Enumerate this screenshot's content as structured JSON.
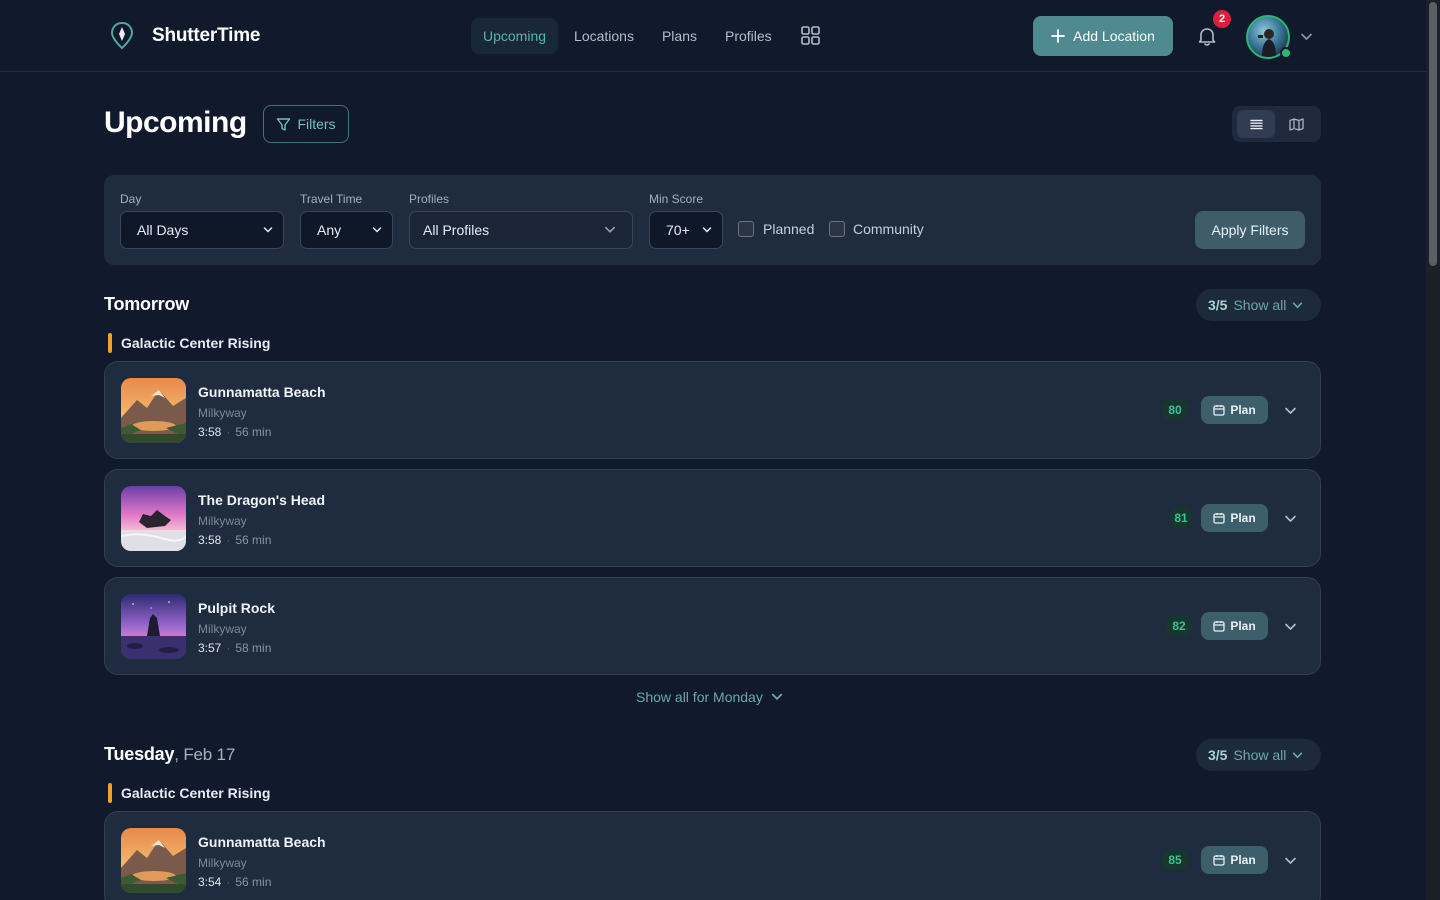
{
  "header": {
    "brand": "ShutterTime",
    "nav": [
      {
        "label": "Upcoming",
        "active": true
      },
      {
        "label": "Locations",
        "active": false
      },
      {
        "label": "Plans",
        "active": false
      },
      {
        "label": "Profiles",
        "active": false
      }
    ],
    "add_location_label": "Add Location",
    "notification_count": "2",
    "icons": [
      "map-pin-logo-icon",
      "grid-icon",
      "plus-icon",
      "bell-icon",
      "chevron-down-icon"
    ]
  },
  "title_row": {
    "title": "Upcoming",
    "filters_label": "Filters",
    "view_modes": [
      "list-icon",
      "map-icon"
    ],
    "active_view": "list"
  },
  "filters": {
    "day": {
      "label": "Day",
      "value": "All Days"
    },
    "travel_time": {
      "label": "Travel Time",
      "value": "Any"
    },
    "profiles": {
      "label": "Profiles",
      "value": "All Profiles"
    },
    "min_score": {
      "label": "Min Score",
      "value": "70+"
    },
    "planned": {
      "label": "Planned",
      "checked": false
    },
    "community": {
      "label": "Community",
      "checked": false
    },
    "apply_label": "Apply Filters"
  },
  "sections": [
    {
      "day": "Tomorrow",
      "date": "",
      "count": "3/5",
      "show_all_label": "Show all",
      "group": "Galactic Center Rising",
      "cards": [
        {
          "name": "Gunnamatta Beach",
          "type": "Milkyway",
          "time": "3:58",
          "duration": "56 min",
          "score": "80",
          "plan_label": "Plan",
          "thumb": "mountain-sunset"
        },
        {
          "name": "The Dragon's Head",
          "type": "Milkyway",
          "time": "3:58",
          "duration": "56 min",
          "score": "81",
          "plan_label": "Plan",
          "thumb": "pink-rock-sea"
        },
        {
          "name": "Pulpit Rock",
          "type": "Milkyway",
          "time": "3:57",
          "duration": "58 min",
          "score": "82",
          "plan_label": "Plan",
          "thumb": "purple-sea-stack"
        }
      ],
      "show_all_day_label": "Show all for Monday"
    },
    {
      "day": "Tuesday",
      "date": ", Feb 17",
      "count": "3/5",
      "show_all_label": "Show all",
      "group": "Galactic Center Rising",
      "cards": [
        {
          "name": "Gunnamatta Beach",
          "type": "Milkyway",
          "time": "3:54",
          "duration": "56 min",
          "score": "85",
          "plan_label": "Plan",
          "thumb": "mountain-sunset"
        }
      ]
    }
  ],
  "colors": {
    "background": "#111a2c",
    "panel": "#1f2b3e",
    "accent": "#58b4ad",
    "score_text": "#3dc391",
    "group_marker": "#f0a12a",
    "badge": "#e01e3c"
  }
}
